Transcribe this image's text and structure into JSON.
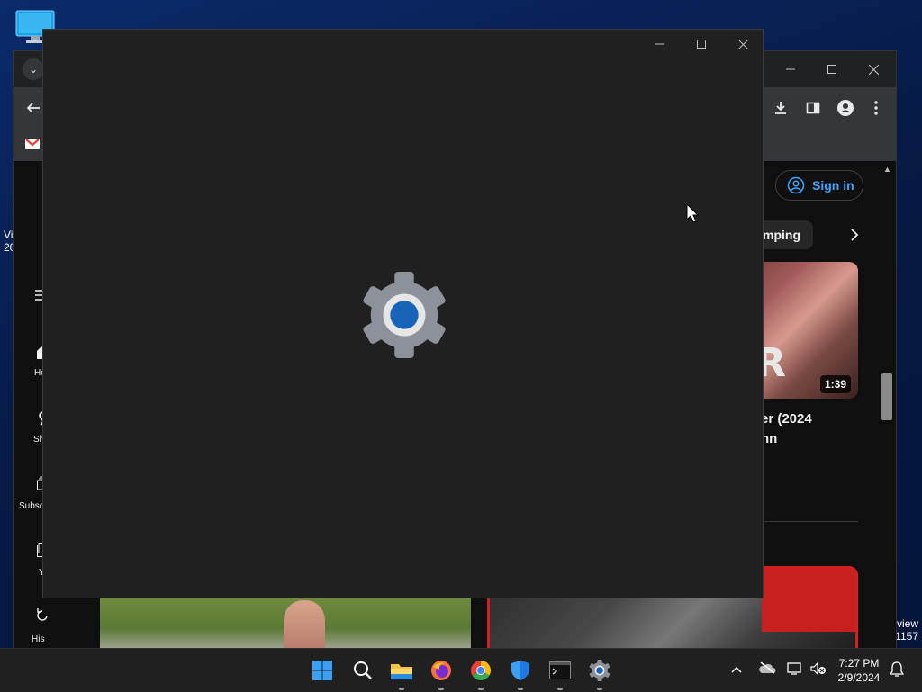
{
  "desktop": {
    "left_label_line1": "Vi",
    "left_label_line2": "20",
    "right_label_line1": "eview",
    "right_label_line2": "1157"
  },
  "browser": {
    "youtube": {
      "sign_in_label": "Sign in",
      "chip_label": "amping",
      "video": {
        "duration": "1:39",
        "title_line1": "er (2024",
        "title_line2": "nn",
        "overlay_text": "R"
      },
      "sidebar": [
        {
          "label": "Ho"
        },
        {
          "label": "Sh"
        },
        {
          "label": "Subsc"
        },
        {
          "label": "Y"
        },
        {
          "label": "His"
        }
      ]
    }
  },
  "settings_window": {
    "state": "loading",
    "icon": "settings-gear-icon"
  },
  "taskbar": {
    "apps": [
      "start-icon",
      "search-icon",
      "file-explorer-icon",
      "firefox-icon",
      "chrome-icon",
      "windows-security-icon",
      "terminal-icon",
      "settings-icon"
    ],
    "time": "7:27 PM",
    "date": "2/9/2024"
  },
  "colors": {
    "accent": "#0067c0",
    "youtube_link": "#3ea6ff",
    "window_bg": "#202020"
  }
}
